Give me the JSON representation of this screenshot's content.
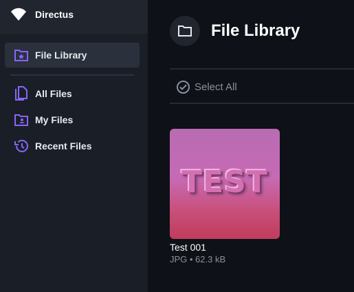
{
  "colors": {
    "accent": "#8866ff",
    "sidebar_bg": "#1a1f27",
    "main_bg": "#0e1117"
  },
  "brand": {
    "name": "Directus",
    "icon": "wifi-logo-icon"
  },
  "sidebar": {
    "items": [
      {
        "label": "File Library",
        "icon": "folder-star-icon",
        "active": true
      },
      {
        "label": "All Files",
        "icon": "files-icon",
        "active": false
      },
      {
        "label": "My Files",
        "icon": "folder-user-icon",
        "active": false
      },
      {
        "label": "Recent Files",
        "icon": "history-icon",
        "active": false
      }
    ]
  },
  "header": {
    "icon": "folder-icon",
    "title": "File Library"
  },
  "toolbar": {
    "select_all_label": "Select All",
    "select_all_icon": "check-circle-icon"
  },
  "files": [
    {
      "title": "Test 001",
      "meta": "JPG • 62.3 kB",
      "thumbnail_text": "TEST"
    }
  ]
}
